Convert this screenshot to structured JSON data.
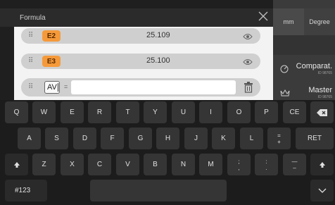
{
  "header": {
    "title": "Formula"
  },
  "units": {
    "length": "mm",
    "angle": "Degree"
  },
  "side_panel": [
    {
      "title": "Comparat.",
      "id": "ID 98765",
      "icon": "gauge-icon"
    },
    {
      "title": "Master",
      "id": "ID 98765",
      "icon": "crown-icon"
    }
  ],
  "rows": [
    {
      "name": "E2",
      "value": "25.109"
    },
    {
      "name": "E3",
      "value": "25.100"
    }
  ],
  "input_row": {
    "name": "AV",
    "equals": "=",
    "value": ""
  },
  "keyboard": {
    "row1": [
      "Q",
      "W",
      "E",
      "R",
      "T",
      "Y",
      "U",
      "I",
      "O",
      "P",
      "CE"
    ],
    "row2": [
      "A",
      "S",
      "D",
      "F",
      "G",
      "H",
      "J",
      "K",
      "L"
    ],
    "row2_symbol": {
      "top": "=",
      "bottom": "+"
    },
    "return_label": "RET",
    "row3": [
      "Z",
      "X",
      "C",
      "V",
      "B",
      "N",
      "M"
    ],
    "row3_symbols": [
      {
        "top": ";",
        "bottom": ","
      },
      {
        "top": ":",
        "bottom": "."
      },
      {
        "top": "—",
        "bottom": "–"
      }
    ],
    "mode_label": "#123"
  },
  "colors": {
    "accent": "#f59a3a",
    "keyboard_bg": "#1c1c1c",
    "key_bg": "#353535"
  }
}
